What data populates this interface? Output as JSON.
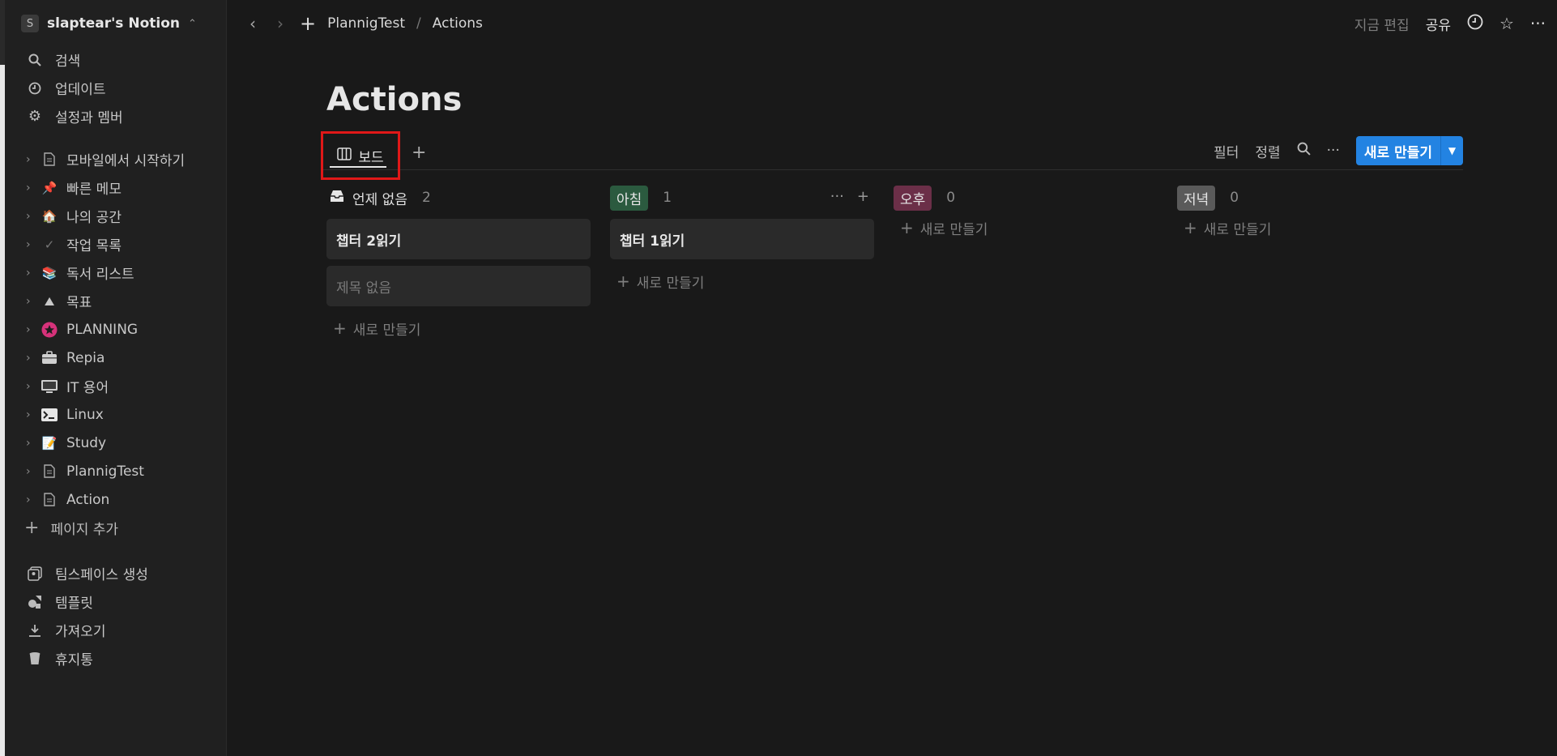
{
  "workspace": {
    "avatar": "S",
    "name": "slaptear's Notion"
  },
  "sidebar": {
    "nav": [
      {
        "label": "검색",
        "icon": "search-icon"
      },
      {
        "label": "업데이트",
        "icon": "clock-icon"
      },
      {
        "label": "설정과 멤버",
        "icon": "gear-icon"
      }
    ],
    "pages": [
      {
        "label": "모바일에서 시작하기",
        "icon": "page-icon"
      },
      {
        "label": "빠른 메모",
        "icon": "pushpin-icon"
      },
      {
        "label": "나의 공간",
        "icon": "house-icon"
      },
      {
        "label": "작업 목록",
        "icon": "checkmark-icon"
      },
      {
        "label": "독서 리스트",
        "icon": "books-icon"
      },
      {
        "label": "목표",
        "icon": "mountain-icon"
      },
      {
        "label": "PLANNING",
        "icon": "star-badge-icon"
      },
      {
        "label": "Repia",
        "icon": "briefcase-icon"
      },
      {
        "label": "IT 용어",
        "icon": "computer-icon"
      },
      {
        "label": "Linux",
        "icon": "terminal-icon"
      },
      {
        "label": "Study",
        "icon": "memo-icon"
      },
      {
        "label": "PlannigTest",
        "icon": "page-icon"
      },
      {
        "label": "Action",
        "icon": "page-icon"
      }
    ],
    "add_page": "페이지 추가",
    "bottom": [
      {
        "label": "팀스페이스 생성",
        "icon": "teamspace-icon"
      },
      {
        "label": "템플릿",
        "icon": "shapes-icon"
      },
      {
        "label": "가져오기",
        "icon": "download-icon"
      },
      {
        "label": "휴지통",
        "icon": "trash-icon"
      }
    ]
  },
  "topbar": {
    "breadcrumb": [
      "PlannigTest",
      "Actions"
    ],
    "edited": "지금 편집",
    "share": "공유"
  },
  "page": {
    "title": "Actions",
    "view_tab": "보드",
    "tools": {
      "filter": "필터",
      "sort": "정렬"
    },
    "new_button": "새로 만들기"
  },
  "board": {
    "new_label": "새로 만들기",
    "columns": [
      {
        "title": "언제 없음",
        "count": "2",
        "chip_color": "",
        "cards": [
          {
            "title": "챕터 2읽기",
            "empty": false
          },
          {
            "title": "제목 없음",
            "empty": true
          }
        ]
      },
      {
        "title": "아침",
        "count": "1",
        "chip_color": "#2b5a3f",
        "cards": [
          {
            "title": "챕터 1읽기",
            "empty": false
          }
        ]
      },
      {
        "title": "오후",
        "count": "0",
        "chip_color": "#6b2f48",
        "cards": []
      },
      {
        "title": "저녁",
        "count": "0",
        "chip_color": "#5a5a5a",
        "cards": []
      }
    ]
  },
  "colors": {
    "accent": "#2383e2",
    "highlight": "#e01818"
  }
}
